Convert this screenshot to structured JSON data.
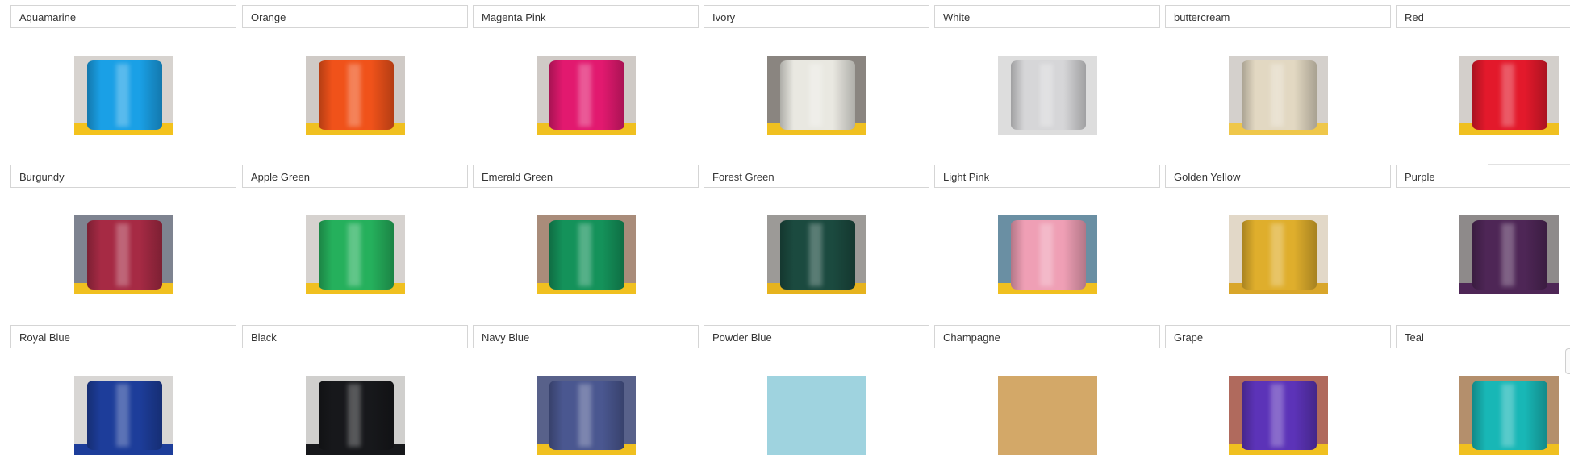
{
  "rows": [
    {
      "items": [
        {
          "label": "Aquamarine",
          "color": "#1aa0e6",
          "bg": "#d7d3cf",
          "base": "#f3c21d",
          "style": "spool"
        },
        {
          "label": "Orange",
          "color": "#f0521a",
          "bg": "#cfcac6",
          "base": "#f0c020",
          "style": "spool"
        },
        {
          "label": "Magenta Pink",
          "color": "#e2196f",
          "bg": "#cfcac6",
          "base": "#f0c020",
          "style": "spool"
        },
        {
          "label": "Ivory",
          "color": "#e9e8e1",
          "bg": "#8a8580",
          "base": "#f0c020",
          "style": "spool"
        },
        {
          "label": "White",
          "color": "#d6d6d8",
          "bg": "#dddddd",
          "base": "#dddddd",
          "style": "spool"
        },
        {
          "label": "buttercream",
          "color": "#e2d8c2",
          "bg": "#d4d0cc",
          "base": "#efc74a",
          "style": "spool"
        },
        {
          "label": "Red",
          "color": "#e3192b",
          "bg": "#d3cfcb",
          "base": "#f0c020",
          "style": "spool"
        }
      ]
    },
    {
      "items": [
        {
          "label": "Burgundy",
          "color": "#a62a44",
          "bg": "#7e8390",
          "base": "#f0c020",
          "style": "spool"
        },
        {
          "label": "Apple Green",
          "color": "#25b05c",
          "bg": "#d6d2cf",
          "base": "#f0c020",
          "style": "spool"
        },
        {
          "label": "Emerald Green",
          "color": "#14925a",
          "bg": "#a98c7a",
          "base": "#f0c020",
          "style": "spool"
        },
        {
          "label": "Forest Green",
          "color": "#1b4a3f",
          "bg": "#9c9a97",
          "base": "#e6b31e",
          "style": "spool"
        },
        {
          "label": "Light Pink",
          "color": "#ef9fb5",
          "bg": "#6a8fa3",
          "base": "#f0c020",
          "style": "spool"
        },
        {
          "label": "Golden Yellow",
          "color": "#dfae2c",
          "bg": "#e2d8c8",
          "base": "#d9a62a",
          "style": "spool"
        },
        {
          "label": "Purple",
          "color": "#4e2656",
          "bg": "#8e8a8a",
          "base": "#4e2656",
          "style": "spool"
        }
      ]
    },
    {
      "items": [
        {
          "label": "Royal Blue",
          "color": "#1d3d9a",
          "bg": "#d8d6d4",
          "base": "#1d3d9a",
          "style": "spool"
        },
        {
          "label": "Black",
          "color": "#17181b",
          "bg": "#d0cfcd",
          "base": "#17181b",
          "style": "spool"
        },
        {
          "label": "Navy Blue",
          "color": "#4a5790",
          "bg": "#58618a",
          "base": "#f0c020",
          "style": "spool"
        },
        {
          "label": "Powder Blue",
          "color": "#9fd3df",
          "bg": "#9fd3df",
          "base": "#9fd3df",
          "style": "flat"
        },
        {
          "label": "Champagne",
          "color": "#d3a868",
          "bg": "#d3a868",
          "base": "#d3a868",
          "style": "flat"
        },
        {
          "label": "Grape",
          "color": "#5c33b8",
          "bg": "#b06a5d",
          "base": "#f0c020",
          "style": "spool"
        },
        {
          "label": "Teal",
          "color": "#18b7b6",
          "bg": "#b48f6c",
          "base": "#f0c020",
          "style": "spool"
        }
      ]
    }
  ]
}
